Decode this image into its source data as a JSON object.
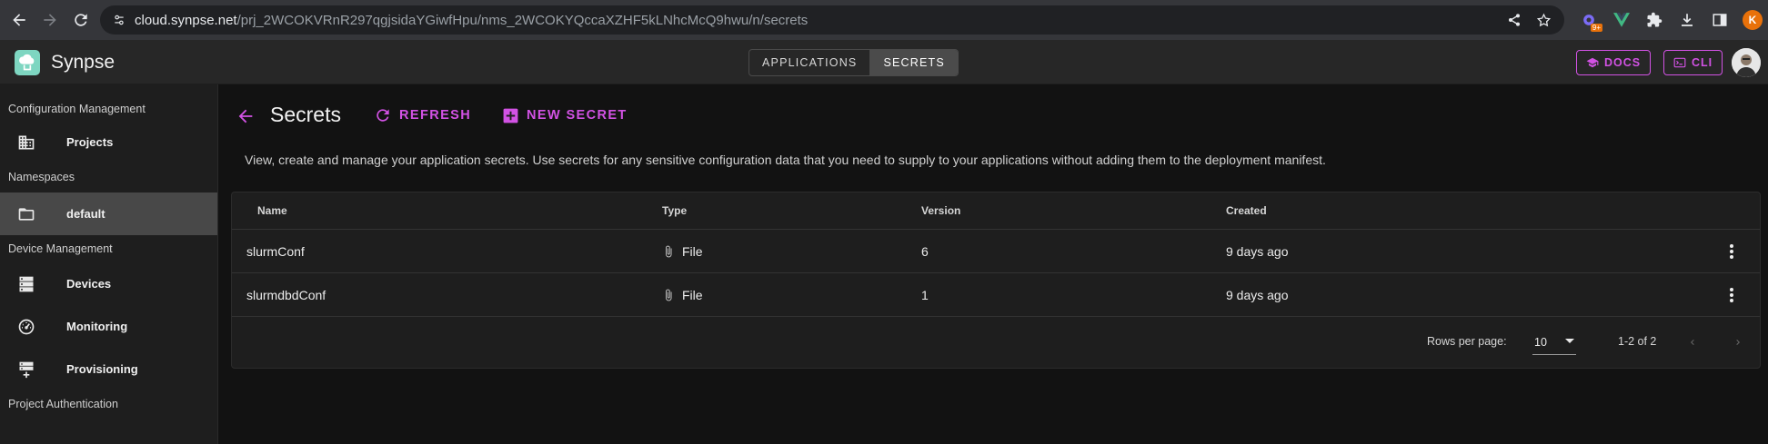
{
  "browser": {
    "url_host": "cloud.synpse.net",
    "url_path": "/prj_2WCOKVRnR297qgjsidaYGiwfHpu/nms_2WCOKYQccaXZHF5kLNhcMcQ9hwu/n/secrets",
    "profile_initial": "K",
    "ext_badge": "9+"
  },
  "app": {
    "brand": "Synpse",
    "tabs": [
      "APPLICATIONS",
      "SECRETS"
    ],
    "active_tab": "SECRETS",
    "docs_label": "DOCS",
    "cli_label": "CLI",
    "accent_color": "#d252e4"
  },
  "sidebar": {
    "sections": [
      {
        "header": "Configuration Management",
        "items": [
          {
            "label": "Projects",
            "icon": "building-icon"
          }
        ]
      },
      {
        "header": "Namespaces",
        "items": [
          {
            "label": "default",
            "icon": "folder-icon",
            "active": true
          }
        ]
      },
      {
        "header": "Device Management",
        "items": [
          {
            "label": "Devices",
            "icon": "server-icon"
          },
          {
            "label": "Monitoring",
            "icon": "speedometer-icon"
          },
          {
            "label": "Provisioning",
            "icon": "server-plus-icon"
          }
        ]
      },
      {
        "header": "Project Authentication",
        "items": []
      }
    ]
  },
  "page": {
    "title": "Secrets",
    "refresh_label": "REFRESH",
    "new_secret_label": "NEW SECRET",
    "description": "View, create and manage your application secrets. Use secrets for any sensitive configuration data that you need to supply to your applications without adding them to the deployment manifest."
  },
  "table": {
    "columns": [
      "Name",
      "Type",
      "Version",
      "Created"
    ],
    "rows": [
      {
        "name": "slurmConf",
        "type": "File",
        "version": "6",
        "created": "9 days ago"
      },
      {
        "name": "slurmdbdConf",
        "type": "File",
        "version": "1",
        "created": "9 days ago"
      }
    ],
    "rows_per_page_label": "Rows per page:",
    "rows_per_page": "10",
    "range": "1-2 of 2"
  }
}
